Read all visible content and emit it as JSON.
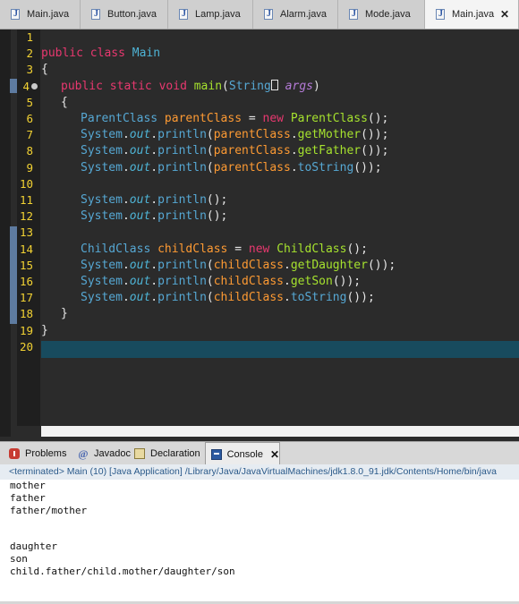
{
  "editor_tabs": [
    {
      "label": "Main.java",
      "active": false
    },
    {
      "label": "Button.java",
      "active": false
    },
    {
      "label": "Lamp.java",
      "active": false
    },
    {
      "label": "Alarm.java",
      "active": false
    },
    {
      "label": "Mode.java",
      "active": false
    },
    {
      "label": "Main.java",
      "active": true,
      "close": "✕"
    }
  ],
  "line_numbers": [
    "1",
    "2",
    "3",
    "4",
    "5",
    "6",
    "7",
    "8",
    "9",
    "10",
    "11",
    "12",
    "13",
    "14",
    "15",
    "16",
    "17",
    "18",
    "19",
    "20"
  ],
  "code": {
    "l2": {
      "kw1": "public",
      "kw2": "class",
      "name": "Main"
    },
    "l3": {
      "brace": "{"
    },
    "l4": {
      "kw1": "public",
      "kw2": "static",
      "kw3": "void",
      "method": "main",
      "open": "(",
      "type": "String",
      "param": "args",
      "close": ")"
    },
    "l5": {
      "brace": "{"
    },
    "l6": {
      "type": "ParentClass",
      "var": "parentClass",
      "eq": " = ",
      "new": "new",
      "ctor": "ParentClass",
      "end": "();"
    },
    "l7": {
      "sys": "System",
      "dot1": ".",
      "out": "out",
      "dot2": ".",
      "fn": "println",
      "open": "(",
      "obj": "parentClass",
      "dot3": ".",
      "call": "getMother",
      "end": "());"
    },
    "l8": {
      "sys": "System",
      "dot1": ".",
      "out": "out",
      "dot2": ".",
      "fn": "println",
      "open": "(",
      "obj": "parentClass",
      "dot3": ".",
      "call": "getFather",
      "end": "());"
    },
    "l9": {
      "sys": "System",
      "dot1": ".",
      "out": "out",
      "dot2": ".",
      "fn": "println",
      "open": "(",
      "obj": "parentClass",
      "dot3": ".",
      "call": "toString",
      "end": "());"
    },
    "l11": {
      "sys": "System",
      "dot1": ".",
      "out": "out",
      "dot2": ".",
      "fn": "println",
      "end": "();"
    },
    "l12": {
      "sys": "System",
      "dot1": ".",
      "out": "out",
      "dot2": ".",
      "fn": "println",
      "end": "();"
    },
    "l14": {
      "type": "ChildClass",
      "var": "childClass",
      "eq": " = ",
      "new": "new",
      "ctor": "ChildClass",
      "end": "();"
    },
    "l15": {
      "sys": "System",
      "dot1": ".",
      "out": "out",
      "dot2": ".",
      "fn": "println",
      "open": "(",
      "obj": "childClass",
      "dot3": ".",
      "call": "getDaughter",
      "end": "());"
    },
    "l16": {
      "sys": "System",
      "dot1": ".",
      "out": "out",
      "dot2": ".",
      "fn": "println",
      "open": "(",
      "obj": "childClass",
      "dot3": ".",
      "call": "getSon",
      "end": "());"
    },
    "l17": {
      "sys": "System",
      "dot1": ".",
      "out": "out",
      "dot2": ".",
      "fn": "println",
      "open": "(",
      "obj": "childClass",
      "dot3": ".",
      "call": "toString",
      "end": "());"
    },
    "l18": {
      "brace": "}"
    },
    "l19": {
      "brace": "}"
    }
  },
  "panel_tabs": [
    {
      "label": "Problems",
      "icon": "problems-icon"
    },
    {
      "label": "Javadoc",
      "icon": "javadoc-icon",
      "glyph": "@"
    },
    {
      "label": "Declaration",
      "icon": "declaration-icon"
    },
    {
      "label": "Console",
      "icon": "console-icon",
      "active": true,
      "close": "✕"
    }
  ],
  "console": {
    "header": "<terminated> Main (10) [Java Application] /Library/Java/JavaVirtualMachines/jdk1.8.0_91.jdk/Contents/Home/bin/java",
    "lines": [
      "mother",
      "father",
      "father/mother",
      "",
      "",
      "daughter",
      "son",
      "child.father/child.mother/daughter/son"
    ]
  },
  "colors": {
    "editor_bg": "#2b2b2b",
    "line_numbers": "#f2d233",
    "keyword": "#e8386f",
    "type": "#4eb4d6",
    "method": "#a6e22e",
    "variable": "#fd9a33",
    "parameter": "#b57bd8",
    "current_line": "#184b5e"
  }
}
